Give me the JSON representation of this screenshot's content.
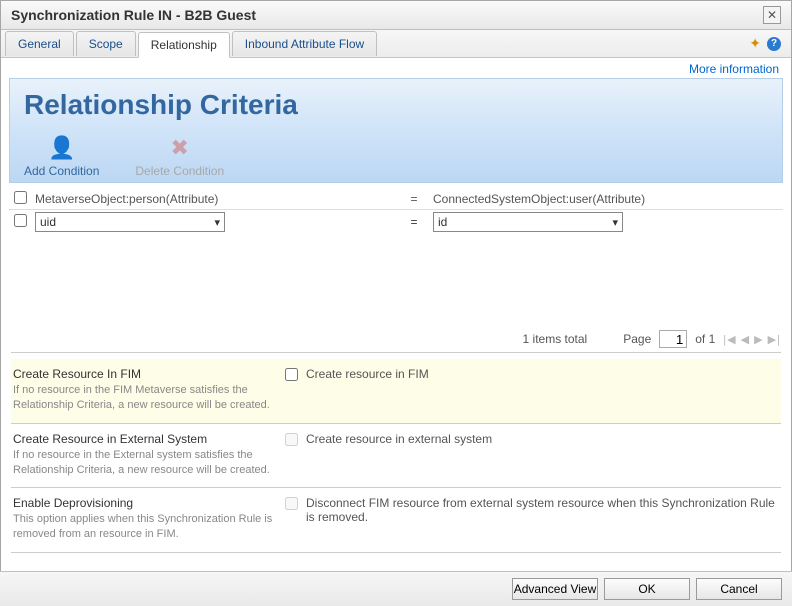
{
  "titlebar": {
    "title": "Synchronization Rule IN - B2B Guest"
  },
  "tabs": {
    "general": "General",
    "scope": "Scope",
    "relationship": "Relationship",
    "inbound": "Inbound Attribute Flow"
  },
  "header_links": {
    "more_info": "More information"
  },
  "banner": {
    "heading": "Relationship Criteria",
    "add_condition": "Add Condition",
    "delete_condition": "Delete Condition"
  },
  "criteria": {
    "left_header": "MetaverseObject:person(Attribute)",
    "right_header": "ConnectedSystemObject:user(Attribute)",
    "eq": "=",
    "row": {
      "left_value": "uid",
      "right_value": "id"
    }
  },
  "pager": {
    "items_total": "1 items total",
    "page_label": "Page",
    "page_value": "1",
    "of_label": "of 1"
  },
  "sections": {
    "fim": {
      "title": "Create Resource In FIM",
      "desc": "If no resource in the FIM Metaverse satisfies the Relationship Criteria, a new resource will be created.",
      "checkbox_label": "Create resource in FIM"
    },
    "ext": {
      "title": "Create Resource in External System",
      "desc": "If no resource in the External system satisfies the Relationship Criteria, a new resource will be created.",
      "checkbox_label": "Create resource in external system"
    },
    "deprov": {
      "title": "Enable Deprovisioning",
      "desc": "This option applies when this Synchronization Rule is removed from an resource in FIM.",
      "checkbox_label": "Disconnect FIM resource from external system resource when this Synchronization Rule is removed."
    }
  },
  "footer": {
    "advanced": "Advanced View",
    "ok": "OK",
    "cancel": "Cancel"
  }
}
